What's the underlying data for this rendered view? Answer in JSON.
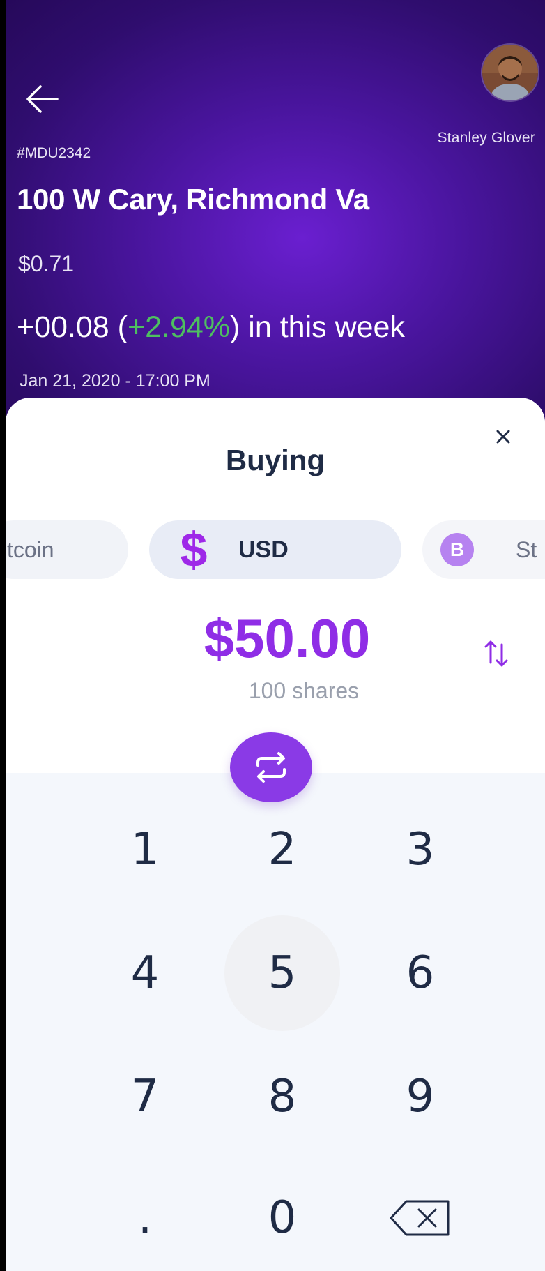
{
  "header": {
    "user_name": "Stanley Glover",
    "property_id": "#MDU2342",
    "property_title": "100 W Cary, Richmond Va",
    "price": "$0.71",
    "change_prefix": "+00.08 (",
    "change_percent": "+2.94%",
    "change_suffix": ") in this week",
    "timestamp": "Jan 21, 2020 - 17:00 PM"
  },
  "sheet": {
    "title": "Buying",
    "currencies": {
      "left_label": "tcoin",
      "center_label": "USD",
      "center_icon": "$",
      "right_label": "St",
      "right_icon": "B"
    },
    "amount": "$50.00",
    "shares": "100 shares"
  },
  "keypad": {
    "keys": [
      "1",
      "2",
      "3",
      "4",
      "5",
      "6",
      "7",
      "8",
      "9",
      ".",
      "0"
    ],
    "pressed": "5"
  },
  "colors": {
    "accent": "#8f2de6",
    "positive": "#4ebf60",
    "header_dark": "#26095a",
    "text_dark": "#1f2b45"
  }
}
